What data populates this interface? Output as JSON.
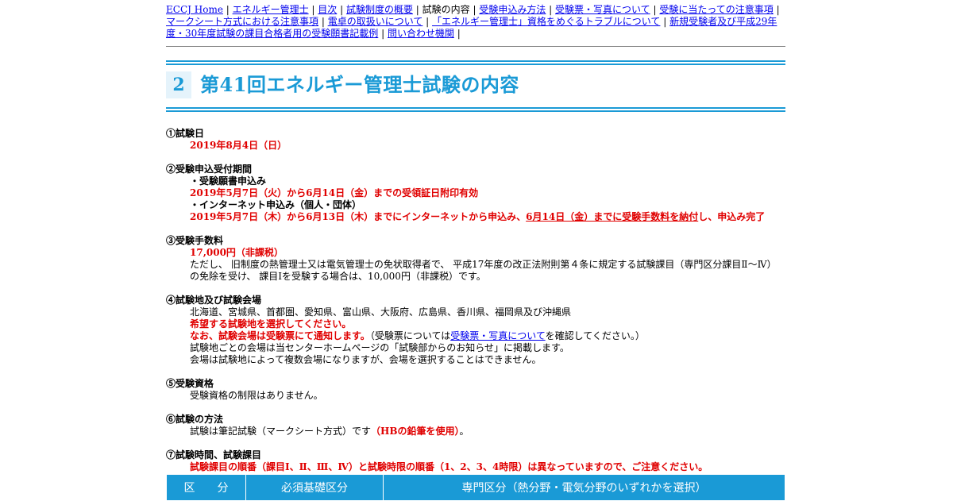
{
  "nav": {
    "links": [
      "ECCJ Home",
      "エネルギー管理士",
      "目次",
      "試験制度の概要",
      "試験の内容",
      "受験申込み方法",
      "受験票・写真について",
      "受験に当たっての注意事項",
      "マークシート方式における注意事項",
      "電卓の取扱いについて",
      "「エネルギー管理士」資格をめぐるトラブルについて",
      "新規受験者及び平成29年度・30年度試験の課目合格者用の受験願書記載例",
      "問い合わせ機関"
    ],
    "sep": " | ",
    "current_index": 4
  },
  "heading": {
    "number": "2",
    "title": "第41回エネルギー管理士試験の内容"
  },
  "sections": {
    "s1": {
      "title": "①試験日",
      "date": "2019年8月4日（日）"
    },
    "s2": {
      "title": "②受験申込受付期間",
      "sub1": "・受験願書申込み",
      "period1": "2019年5月7日（火）から6月14日（金）までの受領証日附印有効",
      "sub2": "・インターネット申込み（個人・団体）",
      "period2a": "2019年5月7日（木）から6月13日（木）までにインターネットから申込み、",
      "period2b": "6月14日（金）までに受験手数料を納付",
      "period2c": "し、申込み完了"
    },
    "s3": {
      "title": "③受験手数料",
      "fee": "17,000円（非課税）",
      "note": "ただし、 旧制度の熱管理士又は電気管理士の免状取得者で、 平成17年度の改正法附則第４条に規定する試験課目（専門区分課目Ⅱ～Ⅳ）の免除を受け、 課目Ⅰを受験する場合は、10,000円（非課税）です。"
    },
    "s4": {
      "title": "④試験地及び試験会場",
      "places": "北海道、宮城県、首都圏、愛知県、富山県、大阪府、広島県、香川県、福岡県及び沖縄県",
      "red1": "希望する試験地を選択してください。",
      "red2": "なお、試験会場は受験票にて通知します。",
      "paren_a": "（受験票については",
      "paren_link": "受験票・写真について",
      "paren_b": "を確認してください。）",
      "line3": "試験地ごとの会場は当センターホームページの「試験部からのお知らせ」に掲載します。",
      "line4": "会場は試験地によって複数会場になりますが、会場を選択することはできません。"
    },
    "s5": {
      "title": "⑤受験資格",
      "text": "受験資格の制限はありません。"
    },
    "s6": {
      "title": "⑥試験の方法",
      "text_a": "試験は筆記試験（マークシート方式）です",
      "text_red": "（HBの鉛筆を使用）",
      "text_b": "。"
    },
    "s7": {
      "title": "⑦試験時間、試験課目",
      "warning": "試験課目の順番（課目Ⅰ、Ⅱ、Ⅲ、Ⅳ）と試験時限の順番（1、2、3、4時限）は異なっていますので、ご注意ください。"
    }
  },
  "table": {
    "headers": [
      "区　　分",
      "必須基礎区分",
      "専門区分（熱分野・電気分野のいずれかを選択）"
    ]
  },
  "colors": {
    "accent": "#1a9ad6",
    "red": "#e00000",
    "link": "#0000ee"
  }
}
